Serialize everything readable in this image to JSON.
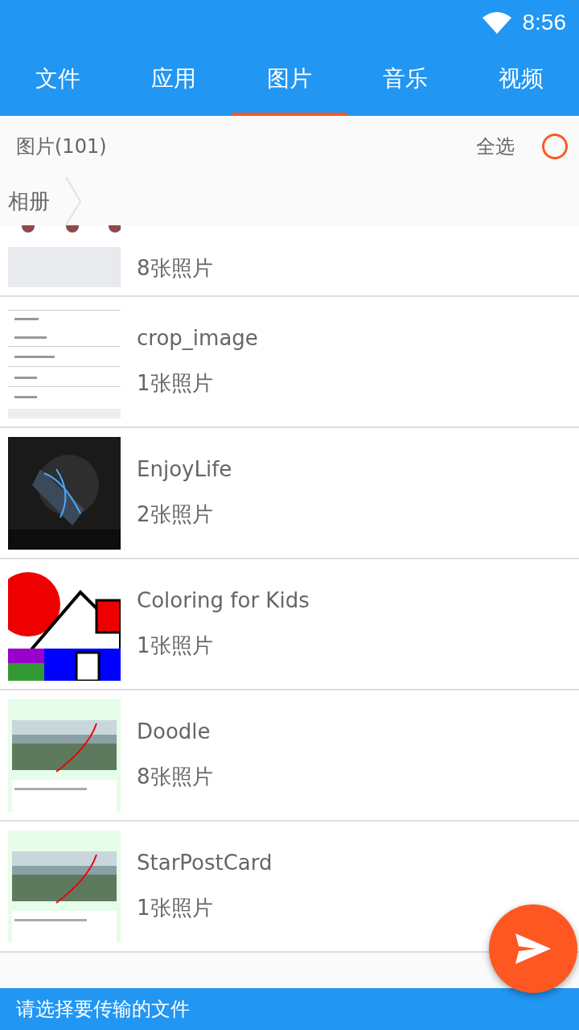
{
  "status_bar": {
    "time": "8:56"
  },
  "tabs": [
    {
      "label": "文件",
      "selected": false
    },
    {
      "label": "应用",
      "selected": false
    },
    {
      "label": "图片",
      "selected": true
    },
    {
      "label": "音乐",
      "selected": false
    },
    {
      "label": "视频",
      "selected": false
    }
  ],
  "header": {
    "title": "图片(101)",
    "select_all": {
      "label": "全选",
      "checked": false
    }
  },
  "breadcrumb": [
    "相册"
  ],
  "albums": [
    {
      "count": "8张照片"
    },
    {
      "name": "crop_image",
      "count": "1张照片"
    },
    {
      "name": "EnjoyLife",
      "count": "2张照片"
    },
    {
      "name": "Coloring for Kids",
      "count": "1张照片"
    },
    {
      "name": "Doodle",
      "count": "8张照片"
    },
    {
      "name": "StarPostCard",
      "count": "1张照片"
    }
  ],
  "bottom_bar": {
    "text": "请选择要传输的文件"
  }
}
